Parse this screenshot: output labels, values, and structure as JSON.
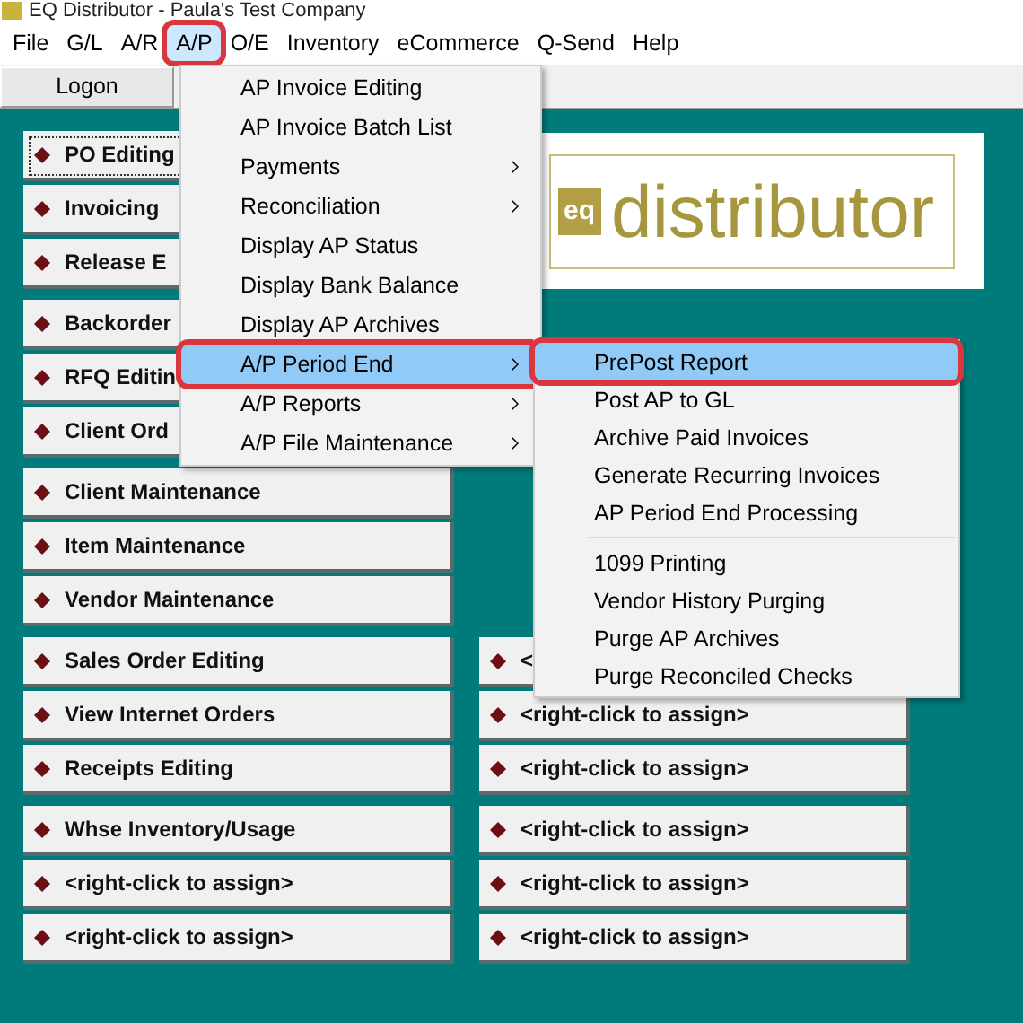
{
  "window": {
    "title": "EQ Distributor - Paula's Test Company"
  },
  "menu_bar": [
    {
      "label": "File",
      "selected": false,
      "annotated": false
    },
    {
      "label": "G/L",
      "selected": false,
      "annotated": false
    },
    {
      "label": "A/R",
      "selected": false,
      "annotated": false
    },
    {
      "label": "A/P",
      "selected": true,
      "annotated": true
    },
    {
      "label": "O/E",
      "selected": false,
      "annotated": false
    },
    {
      "label": "Inventory",
      "selected": false,
      "annotated": false
    },
    {
      "label": "eCommerce",
      "selected": false,
      "annotated": false
    },
    {
      "label": "Q-Send",
      "selected": false,
      "annotated": false
    },
    {
      "label": "Help",
      "selected": false,
      "annotated": false
    }
  ],
  "toolbar": {
    "buttons": [
      "Logon"
    ]
  },
  "menu": {
    "items": [
      {
        "label": "AP Invoice Editing",
        "submenu": false,
        "selected": false,
        "annotated": false
      },
      {
        "label": "AP Invoice Batch List",
        "submenu": false,
        "selected": false,
        "annotated": false
      },
      {
        "label": "Payments",
        "submenu": true,
        "selected": false,
        "annotated": false
      },
      {
        "label": "Reconciliation",
        "submenu": true,
        "selected": false,
        "annotated": false
      },
      {
        "label": "Display AP Status",
        "submenu": false,
        "selected": false,
        "annotated": false
      },
      {
        "label": "Display Bank Balance",
        "submenu": false,
        "selected": false,
        "annotated": false
      },
      {
        "label": "Display AP Archives",
        "submenu": false,
        "selected": false,
        "annotated": false
      },
      {
        "label": "A/P Period End",
        "submenu": true,
        "selected": true,
        "annotated": true
      },
      {
        "label": "A/P Reports",
        "submenu": true,
        "selected": false,
        "annotated": false
      },
      {
        "label": "A/P File Maintenance",
        "submenu": true,
        "selected": false,
        "annotated": false
      }
    ]
  },
  "submenu": {
    "items": [
      {
        "label": "PrePost Report",
        "selected": true,
        "annotated": true,
        "separator_before": false
      },
      {
        "label": "Post AP to GL",
        "selected": false,
        "annotated": false,
        "separator_before": false
      },
      {
        "label": "Archive Paid Invoices",
        "selected": false,
        "annotated": false,
        "separator_before": false
      },
      {
        "label": "Generate Recurring Invoices",
        "selected": false,
        "annotated": false,
        "separator_before": false
      },
      {
        "label": "AP Period End Processing",
        "selected": false,
        "annotated": false,
        "separator_before": false
      },
      {
        "label": "1099 Printing",
        "selected": false,
        "annotated": false,
        "separator_before": true
      },
      {
        "label": "Vendor History Purging",
        "selected": false,
        "annotated": false,
        "separator_before": false
      },
      {
        "label": "Purge AP Archives",
        "selected": false,
        "annotated": false,
        "separator_before": false
      },
      {
        "label": "Purge Reconciled Checks",
        "selected": false,
        "annotated": false,
        "separator_before": false
      }
    ]
  },
  "logo": {
    "badge": "eq",
    "text": "distributor"
  },
  "button_groups": [
    {
      "left": [
        {
          "label": "PO Editing",
          "focused": true
        },
        {
          "label": "Invoicing",
          "focused": false
        },
        {
          "label": "Release E",
          "focused": false
        }
      ]
    },
    {
      "left": [
        {
          "label": "Backorder",
          "focused": false
        },
        {
          "label": "RFQ Editin",
          "focused": false
        },
        {
          "label": "Client Ord",
          "focused": false
        }
      ]
    },
    {
      "left": [
        {
          "label": "Client Maintenance",
          "focused": false
        },
        {
          "label": "Item Maintenance",
          "focused": false
        },
        {
          "label": "Vendor Maintenance",
          "focused": false
        }
      ]
    },
    {
      "left": [
        {
          "label": "Sales Order Editing",
          "focused": false
        },
        {
          "label": "View Internet Orders",
          "focused": false
        },
        {
          "label": "Receipts Editing",
          "focused": false
        }
      ],
      "right": [
        {
          "label": "<",
          "focused": false
        },
        {
          "label": "<right-click to assign>",
          "focused": false
        },
        {
          "label": "<right-click to assign>",
          "focused": false
        }
      ]
    },
    {
      "left": [
        {
          "label": "Whse Inventory/Usage",
          "focused": false
        },
        {
          "label": "<right-click to assign>",
          "focused": false
        },
        {
          "label": "<right-click to assign>",
          "focused": false
        }
      ],
      "right": [
        {
          "label": "<right-click to assign>",
          "focused": false
        },
        {
          "label": "<right-click to assign>",
          "focused": false
        },
        {
          "label": "<right-click to assign>",
          "focused": false
        }
      ]
    }
  ]
}
